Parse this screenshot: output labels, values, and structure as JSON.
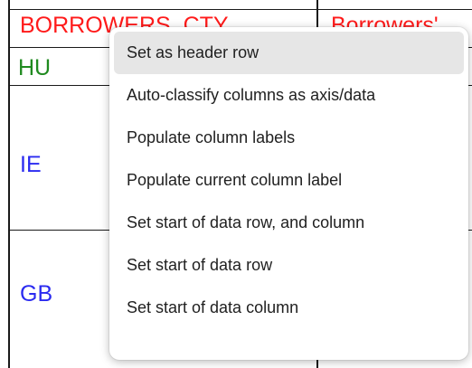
{
  "table": {
    "row1": {
      "col1": "BORROWERS_CTY",
      "col2": "Borrowers'"
    },
    "row2": {
      "col1": "HU"
    },
    "row3": {
      "col1": "IE"
    },
    "row4": {
      "col1": "GB"
    }
  },
  "context_menu": {
    "items": [
      {
        "label": "Set as header row",
        "hovered": true
      },
      {
        "label": "Auto-classify columns as axis/data",
        "hovered": false
      },
      {
        "label": "Populate column labels",
        "hovered": false
      },
      {
        "label": "Populate current column label",
        "hovered": false
      },
      {
        "label": "Set start of data row, and column",
        "hovered": false
      },
      {
        "label": "Set start of data row",
        "hovered": false
      },
      {
        "label": "Set start of data column",
        "hovered": false
      }
    ]
  },
  "colors": {
    "header_text": "#ff1a1a",
    "green_text": "#1f8a1f",
    "blue_text": "#2a2af0",
    "menu_hover": "#e6e6e6"
  }
}
